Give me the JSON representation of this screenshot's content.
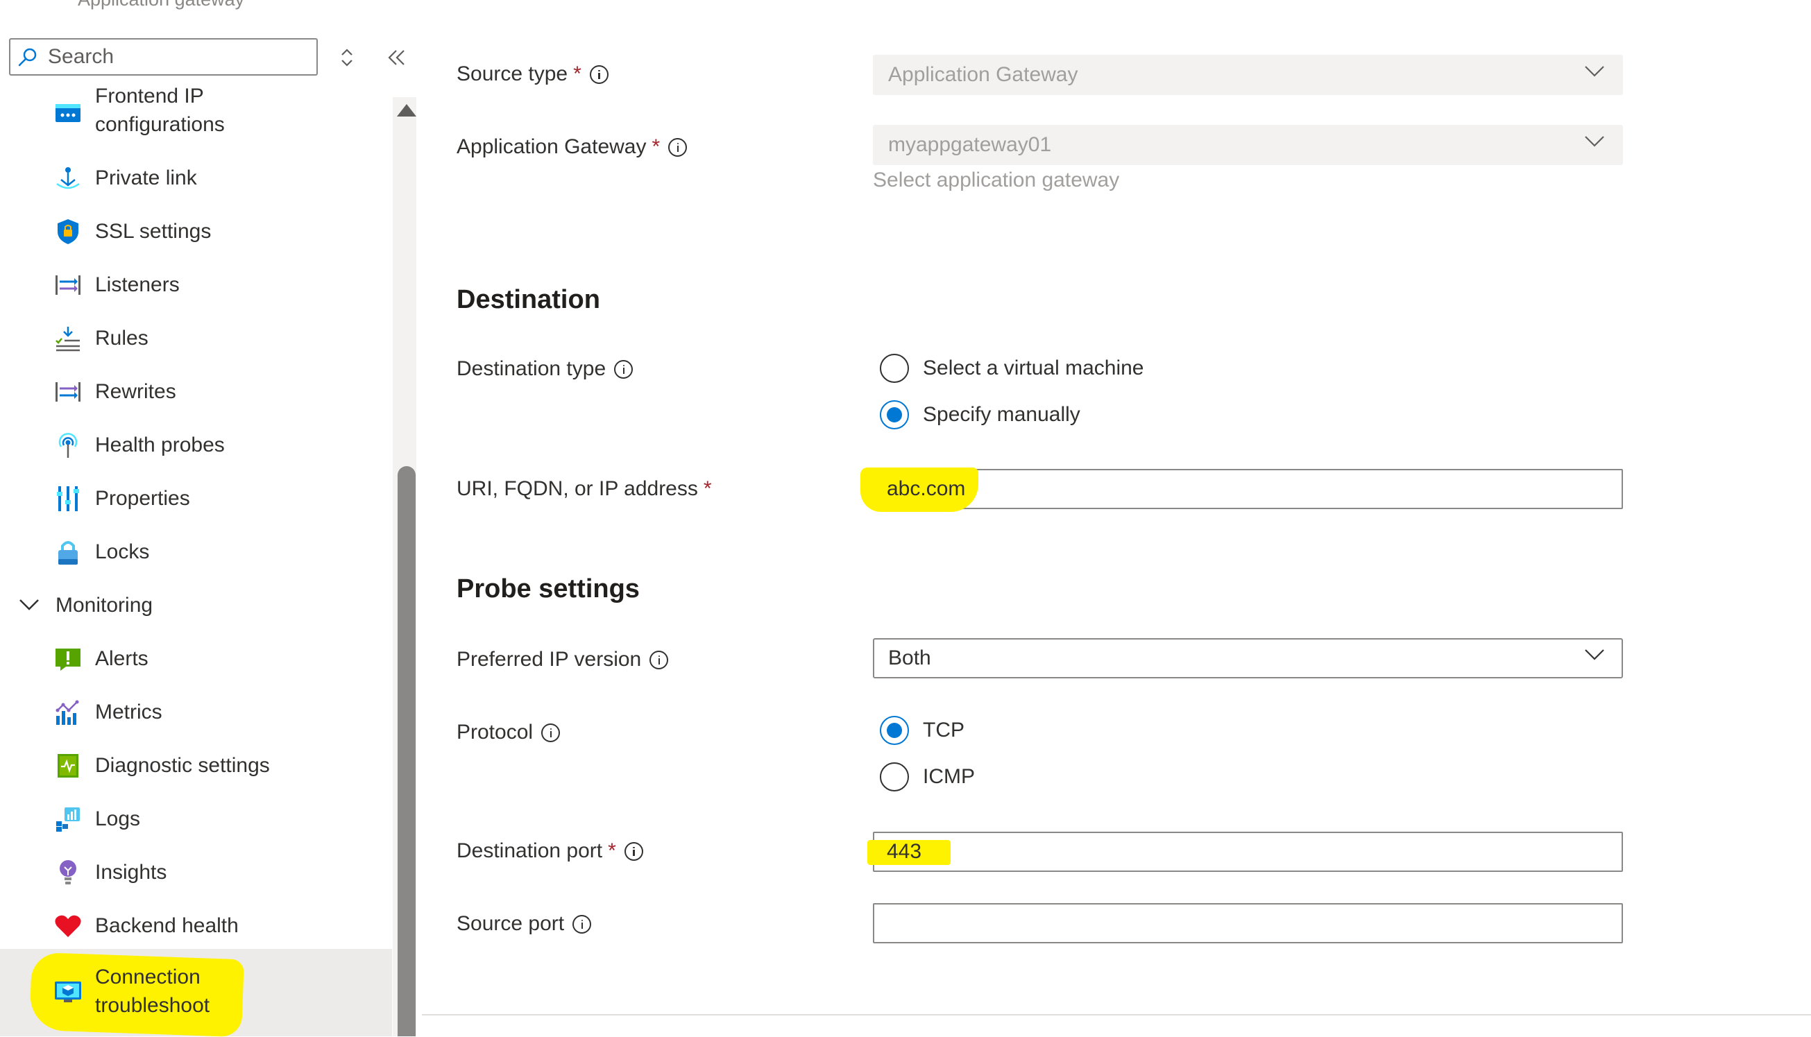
{
  "header": {
    "resource_type": "Application gateway"
  },
  "sidebar": {
    "search_placeholder": "Search",
    "items": [
      {
        "label_line1": "Frontend IP",
        "label_line2": "configurations",
        "icon": "frontend-ip-icon"
      },
      {
        "label": "Private link",
        "icon": "private-link-icon"
      },
      {
        "label": "SSL settings",
        "icon": "ssl-shield-icon"
      },
      {
        "label": "Listeners",
        "icon": "listeners-icon"
      },
      {
        "label": "Rules",
        "icon": "rules-icon"
      },
      {
        "label": "Rewrites",
        "icon": "rewrites-icon"
      },
      {
        "label": "Health probes",
        "icon": "health-probe-icon"
      },
      {
        "label": "Properties",
        "icon": "properties-icon"
      },
      {
        "label": "Locks",
        "icon": "lock-icon"
      }
    ],
    "monitoring_group": {
      "label": "Monitoring",
      "items": [
        {
          "label": "Alerts",
          "icon": "alerts-icon"
        },
        {
          "label": "Metrics",
          "icon": "metrics-icon"
        },
        {
          "label": "Diagnostic settings",
          "icon": "diagnostic-settings-icon"
        },
        {
          "label": "Logs",
          "icon": "logs-icon"
        },
        {
          "label": "Insights",
          "icon": "insights-icon"
        },
        {
          "label": "Backend health",
          "icon": "heart-icon"
        },
        {
          "label_line1": "Connection",
          "label_line2": "troubleshoot",
          "icon": "connection-troubleshoot-icon",
          "selected": true
        }
      ]
    }
  },
  "form": {
    "source_type": {
      "label": "Source type",
      "value": "Application Gateway",
      "required": "*"
    },
    "application_gateway": {
      "label": "Application Gateway",
      "value": "myappgateway01",
      "hint": "Select application gateway",
      "required": "*"
    },
    "destination_section": "Destination",
    "destination_type": {
      "label": "Destination type",
      "options": [
        {
          "label": "Select a virtual machine",
          "checked": false
        },
        {
          "label": "Specify manually",
          "checked": true
        }
      ]
    },
    "uri": {
      "label": "URI, FQDN, or IP address",
      "value": "abc.com",
      "required": "*"
    },
    "probe_section": "Probe settings",
    "preferred_ip_version": {
      "label": "Preferred IP version",
      "value": "Both"
    },
    "protocol": {
      "label": "Protocol",
      "options": [
        {
          "label": "TCP",
          "checked": true
        },
        {
          "label": "ICMP",
          "checked": false
        }
      ]
    },
    "destination_port": {
      "label": "Destination port",
      "value": "443",
      "required": "*"
    },
    "source_port": {
      "label": "Source port",
      "value": ""
    }
  },
  "colors": {
    "accent": "#0078d4",
    "highlight": "#fff200",
    "required": "#a4262c"
  }
}
